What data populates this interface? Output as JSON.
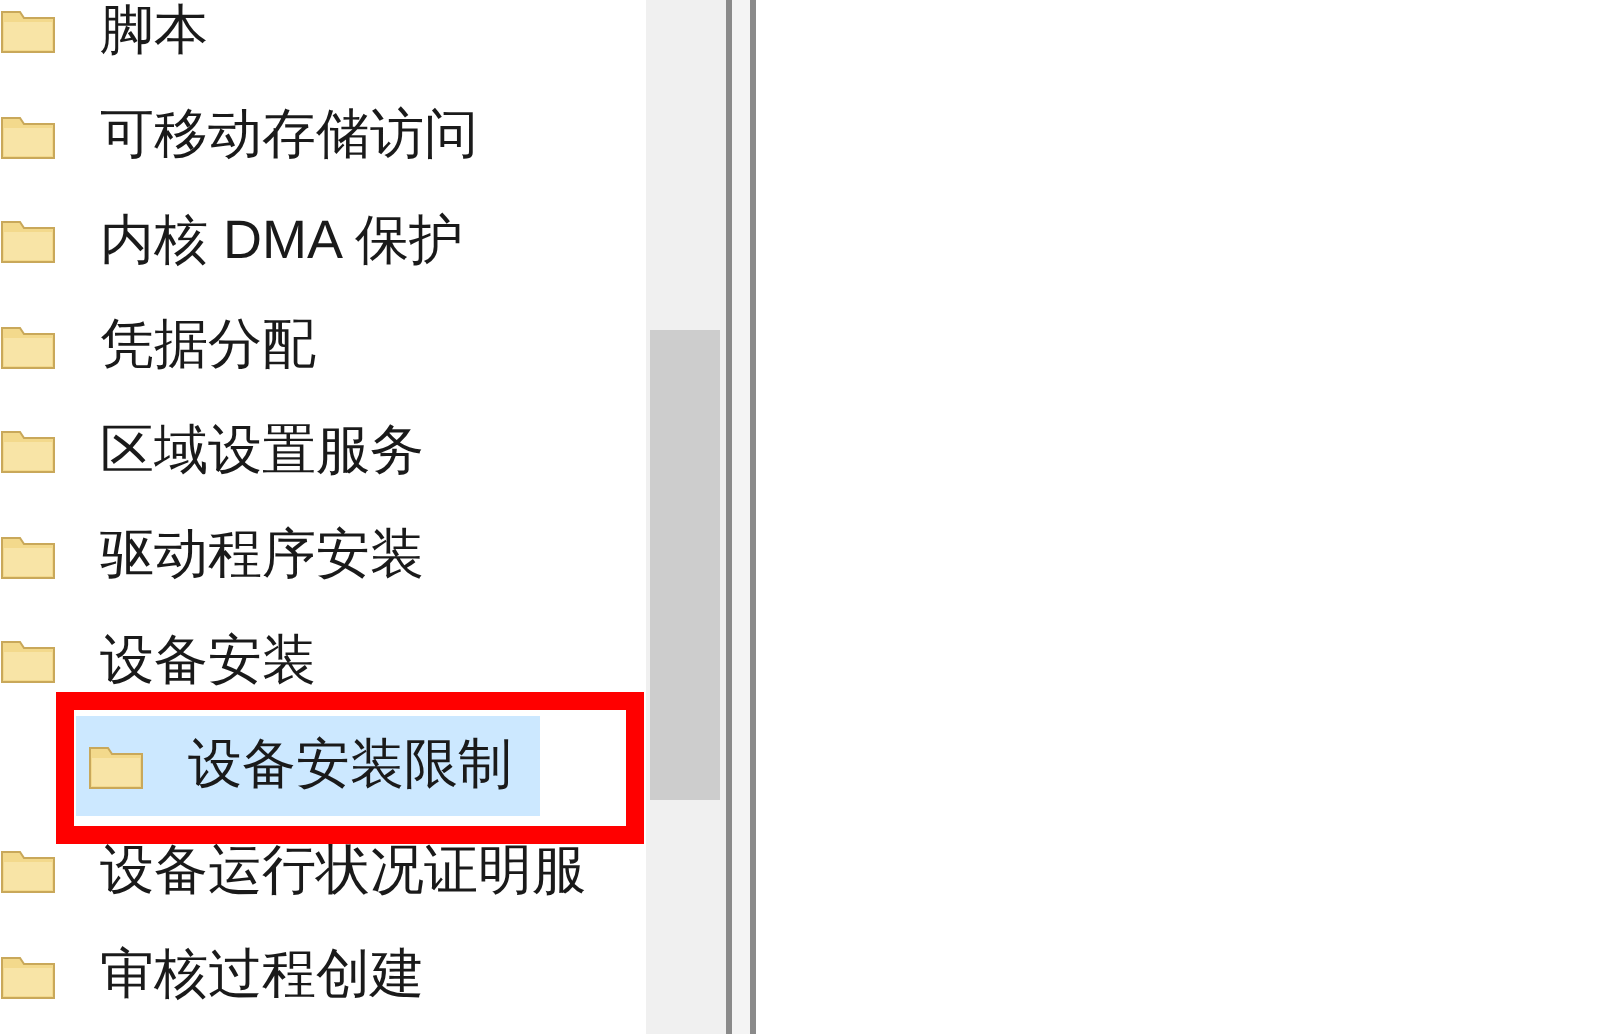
{
  "tree": {
    "items": [
      {
        "label": "脚本",
        "selected": false
      },
      {
        "label": "可移动存储访问",
        "selected": false
      },
      {
        "label": "内核 DMA 保护",
        "selected": false
      },
      {
        "label": "凭据分配",
        "selected": false
      },
      {
        "label": "区域设置服务",
        "selected": false
      },
      {
        "label": "驱动程序安装",
        "selected": false
      },
      {
        "label": "设备安装",
        "selected": false,
        "children": [
          {
            "label": "设备安装限制",
            "selected": true
          }
        ]
      },
      {
        "label": "设备运行状况证明服",
        "selected": false
      },
      {
        "label": "审核过程创建",
        "selected": false
      }
    ]
  },
  "annotation": {
    "kind": "highlight-frame",
    "color": "#ff0000"
  }
}
